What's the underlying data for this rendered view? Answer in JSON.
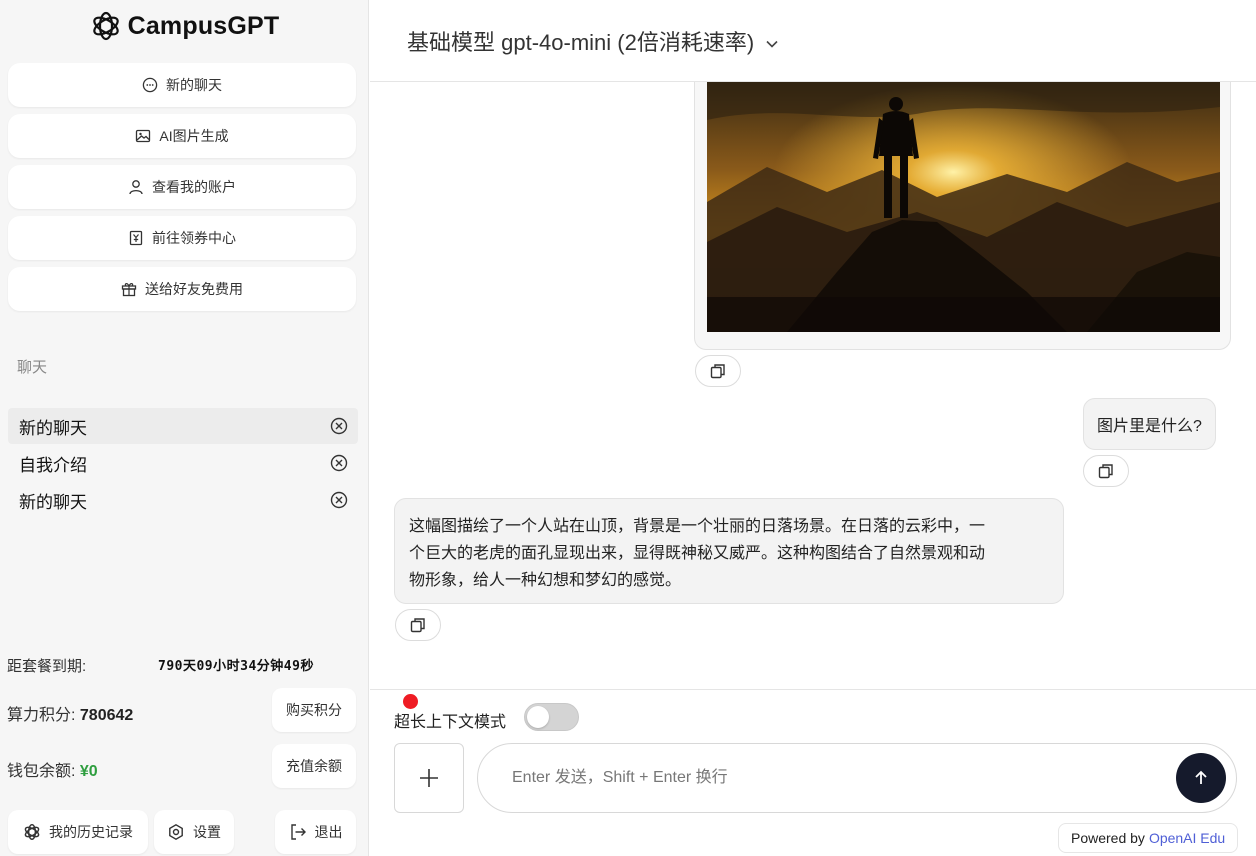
{
  "brand": {
    "name": "CampusGPT"
  },
  "sidebar": {
    "nav": [
      {
        "label": "新的聊天",
        "icon": "chat-bubble-icon"
      },
      {
        "label": "AI图片生成",
        "icon": "image-icon"
      },
      {
        "label": "查看我的账户",
        "icon": "user-icon"
      },
      {
        "label": "前往领券中心",
        "icon": "coupon-icon"
      },
      {
        "label": "送给好友免费用",
        "icon": "gift-icon"
      }
    ],
    "section_label": "聊天",
    "chats": [
      {
        "title": "新的聊天",
        "active": true
      },
      {
        "title": "自我介绍",
        "active": false
      },
      {
        "title": "新的聊天",
        "active": false
      }
    ],
    "expire_label": "距套餐到期:",
    "expire_value": "790天09小时34分钟49秒",
    "points_label": "算力积分:",
    "points_value": "780642",
    "buy_points": "购买积分",
    "wallet_label": "钱包余额:",
    "wallet_value": "¥0",
    "recharge": "充值余额",
    "history": "我的历史记录",
    "settings": "设置",
    "logout": "退出"
  },
  "header": {
    "model_title": "基础模型 gpt-4o-mini (2倍消耗速率)"
  },
  "messages": {
    "user_question": "图片里是什么?",
    "assistant_line1": "这幅图描绘了一个人站在山顶，背景是一个壮丽的日落场景。在日落的云彩中，一",
    "assistant_line2": "个巨大的老虎的面孔显现出来，显得既神秘又威严。这种构图结合了自然景观和动",
    "assistant_line3": "物形象，给人一种幻想和梦幻的感觉。"
  },
  "composer": {
    "context_label": "超长上下文模式",
    "context_enabled": false,
    "placeholder": "Enter 发送，Shift + Enter 换行",
    "value": ""
  },
  "footer": {
    "powered_by": "Powered by",
    "powered_link": "OpenAI Edu"
  },
  "colors": {
    "accent": "#151a2c",
    "money": "#2e9e3f",
    "link": "#4f5fd6",
    "notify": "#ef1c24"
  }
}
